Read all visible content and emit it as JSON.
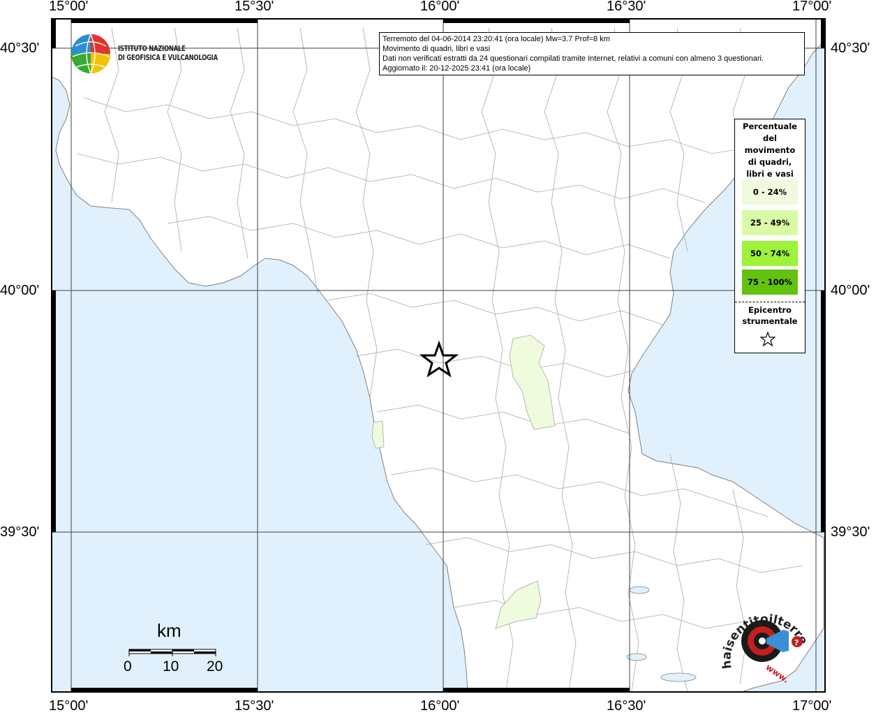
{
  "map": {
    "longitude_labels": [
      "15°00'",
      "15°30'",
      "16°00'",
      "16°30'",
      "17°00'"
    ],
    "latitude_labels": [
      "40°30'",
      "40°00'",
      "39°30'"
    ]
  },
  "info": {
    "line1": "Terremoto del 04-06-2014 23:20:41 (ora locale) Mw=3.7 Prof=8 km",
    "line2": "Movimento di quadri, libri e vasi",
    "line3": "Dati non verificati estratti da 24 questionari compilati tramite Internet, relativi a comuni con almeno 3 questionari.",
    "line4": "Aggiornato il: 20-12-2025 23:41 (ora locale)"
  },
  "legend": {
    "title_lines": [
      "Percentuale",
      "del",
      "movimento",
      "di quadri,",
      "libri e vasi"
    ],
    "classes": [
      {
        "label": "0 - 24%",
        "color": "#eefbdc"
      },
      {
        "label": "25 - 49%",
        "color": "#d9fba5"
      },
      {
        "label": "50 - 74%",
        "color": "#9df23a"
      },
      {
        "label": "75 - 100%",
        "color": "#62c20e"
      }
    ],
    "epicenter_lines": [
      "Epicentro",
      "strumentale"
    ],
    "epicenter_icon": "star-outline-icon"
  },
  "ingv": {
    "name_line1": "ISTITUTO NAZIONALE",
    "name_line2": "DI GEOFISICA E VULCANOLOGIA"
  },
  "scale": {
    "unit": "km",
    "ticks": [
      "0",
      "10",
      "20"
    ]
  },
  "hst_logo": {
    "text": "haisentitoilterremoto.it",
    "text_www": "www."
  },
  "colors": {
    "sea": "#e0f1fd",
    "land": "#ffffff",
    "borders": "#a0a0a0",
    "grid": "#404040",
    "low_class": "#eefbdc"
  }
}
